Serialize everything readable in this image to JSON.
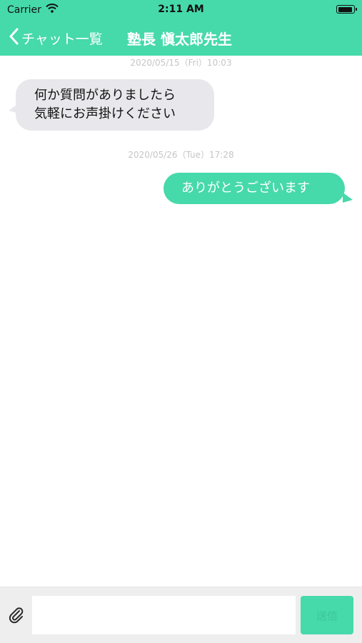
{
  "status_bar": {
    "carrier": "Carrier",
    "time": "2:11 AM"
  },
  "nav": {
    "back_label": "チャット一覧",
    "title": "塾長 愼太郎先生"
  },
  "messages": [
    {
      "timestamp": "2020/05/15（Fri）10:03",
      "side": "incoming",
      "lines": [
        "何か質問がありましたら",
        "気軽にお声掛けください"
      ]
    },
    {
      "timestamp": "2020/05/26（Tue）17:28",
      "side": "outgoing",
      "lines": [
        "ありがとうございます"
      ]
    }
  ],
  "input": {
    "value": "",
    "placeholder": "",
    "send_label": "送信"
  },
  "colors": {
    "accent": "#46d9aa",
    "incoming_bubble": "#e8e8ec",
    "timestamp": "#c5c5c5"
  }
}
